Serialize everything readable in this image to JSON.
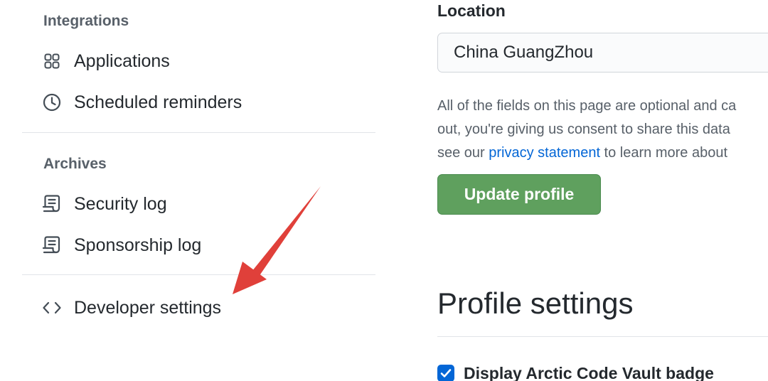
{
  "sidebar": {
    "integrations_heading": "Integrations",
    "integrations_items": [
      {
        "label": "Applications",
        "icon": "apps-grid-icon"
      },
      {
        "label": "Scheduled reminders",
        "icon": "clock-icon"
      }
    ],
    "archives_heading": "Archives",
    "archives_items": [
      {
        "label": "Security log",
        "icon": "log-icon"
      },
      {
        "label": "Sponsorship log",
        "icon": "log-icon"
      }
    ],
    "developer_settings": {
      "label": "Developer settings",
      "icon": "code-icon"
    }
  },
  "main": {
    "location_label": "Location",
    "location_value": "China GuangZhou",
    "help_line1": "All of the fields on this page are optional and ca",
    "help_line2": "out, you're giving us consent to share this data",
    "help_line3_before": "see our ",
    "help_link": "privacy statement",
    "help_line3_after": " to learn more about",
    "update_button": "Update profile",
    "profile_settings_heading": "Profile settings",
    "arctic_badge_label": "Display Arctic Code Vault badge",
    "arctic_badge_checked": true
  },
  "colors": {
    "accent": "#0366d6",
    "button_green": "#5fa05e",
    "annotation_arrow": "#e0403a"
  }
}
